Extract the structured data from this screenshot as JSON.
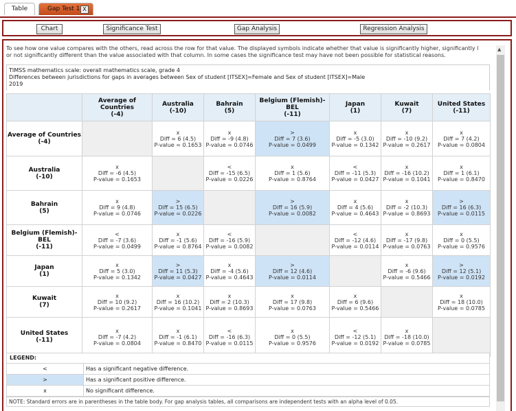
{
  "tabs": [
    {
      "label": "Table"
    },
    {
      "label": "Gap Test 1",
      "close": "X"
    }
  ],
  "toolbar": {
    "chart": "Chart",
    "significance": "Significance Test",
    "gap": "Gap Analysis",
    "regression": "Regression Analysis"
  },
  "intro": [
    "To see how one value compares with the others, read across the row for that value. The displayed symbols indicate whether that value is significantly higher, significantly l",
    "or not significantly different than the value associated with that column. In some cases the significance test may have not been possible for statistical reasons."
  ],
  "header": {
    "line1": "TIMSS mathematics scale: overall mathematics scale, grade 4",
    "line2": "Differences between jurisdictions for gaps in averages between Sex of student [ITSEX]=Female and Sex of student [ITSEX]=Male",
    "line3": "2019"
  },
  "table": {
    "columns": [
      {
        "name": "Average of Countries",
        "value": "(-4)"
      },
      {
        "name": "Australia",
        "value": "(-10)"
      },
      {
        "name": "Bahrain",
        "value": "(5)"
      },
      {
        "name": "Belgium (Flemish)-BEL",
        "value": "(-11)"
      },
      {
        "name": "Japan",
        "value": "(1)"
      },
      {
        "name": "Kuwait",
        "value": "(7)"
      },
      {
        "name": "United States",
        "value": "(-11)"
      }
    ],
    "rows": [
      {
        "name": "Average of Countries",
        "value": "(-4)",
        "cells": [
          null,
          {
            "sym": "x",
            "diff": "Diff = 6 (4.5)",
            "p": "P-value = 0.1653",
            "pos": false
          },
          {
            "sym": "x",
            "diff": "Diff = -9 (4.8)",
            "p": "P-value = 0.0746",
            "pos": false
          },
          {
            "sym": ">",
            "diff": "Diff = 7 (3.6)",
            "p": "P-value = 0.0499",
            "pos": true
          },
          {
            "sym": "x",
            "diff": "Diff = -5 (3.0)",
            "p": "P-value = 0.1342",
            "pos": false
          },
          {
            "sym": "x",
            "diff": "Diff = -10 (9.2)",
            "p": "P-value = 0.2617",
            "pos": false
          },
          {
            "sym": "x",
            "diff": "Diff = 7 (4.2)",
            "p": "P-value = 0.0804",
            "pos": false
          }
        ]
      },
      {
        "name": "Australia",
        "value": "(-10)",
        "cells": [
          {
            "sym": "x",
            "diff": "Diff = -6 (4.5)",
            "p": "P-value = 0.1653",
            "pos": false
          },
          null,
          {
            "sym": "<",
            "diff": "Diff = -15 (6.5)",
            "p": "P-value = 0.0226",
            "pos": false
          },
          {
            "sym": "x",
            "diff": "Diff = 1 (5.6)",
            "p": "P-value = 0.8764",
            "pos": false
          },
          {
            "sym": "<",
            "diff": "Diff = -11 (5.3)",
            "p": "P-value = 0.0427",
            "pos": false
          },
          {
            "sym": "x",
            "diff": "Diff = -16 (10.2)",
            "p": "P-value = 0.1041",
            "pos": false
          },
          {
            "sym": "x",
            "diff": "Diff = 1 (6.1)",
            "p": "P-value = 0.8470",
            "pos": false
          }
        ]
      },
      {
        "name": "Bahrain",
        "value": "(5)",
        "cells": [
          {
            "sym": "x",
            "diff": "Diff = 9 (4.8)",
            "p": "P-value = 0.0746",
            "pos": false
          },
          {
            "sym": ">",
            "diff": "Diff = 15 (6.5)",
            "p": "P-value = 0.0226",
            "pos": true
          },
          null,
          {
            "sym": ">",
            "diff": "Diff = 16 (5.9)",
            "p": "P-value = 0.0082",
            "pos": true
          },
          {
            "sym": "x",
            "diff": "Diff = 4 (5.6)",
            "p": "P-value = 0.4643",
            "pos": false
          },
          {
            "sym": "x",
            "diff": "Diff = -2 (10.3)",
            "p": "P-value = 0.8693",
            "pos": false
          },
          {
            "sym": ">",
            "diff": "Diff = 16 (6.3)",
            "p": "P-value = 0.0115",
            "pos": true
          }
        ]
      },
      {
        "name": "Belgium (Flemish)-BEL",
        "value": "(-11)",
        "cells": [
          {
            "sym": "<",
            "diff": "Diff = -7 (3.6)",
            "p": "P-value = 0.0499",
            "pos": false
          },
          {
            "sym": "x",
            "diff": "Diff = -1 (5.6)",
            "p": "P-value = 0.8764",
            "pos": false
          },
          {
            "sym": "<",
            "diff": "Diff = -16 (5.9)",
            "p": "P-value = 0.0082",
            "pos": false
          },
          null,
          {
            "sym": "<",
            "diff": "Diff = -12 (4.6)",
            "p": "P-value = 0.0114",
            "pos": false
          },
          {
            "sym": "x",
            "diff": "Diff = -17 (9.8)",
            "p": "P-value = 0.0763",
            "pos": false
          },
          {
            "sym": "x",
            "diff": "Diff = 0 (5.5)",
            "p": "P-value = 0.9576",
            "pos": false
          }
        ]
      },
      {
        "name": "Japan",
        "value": "(1)",
        "cells": [
          {
            "sym": "x",
            "diff": "Diff = 5 (3.0)",
            "p": "P-value = 0.1342",
            "pos": false
          },
          {
            "sym": ">",
            "diff": "Diff = 11 (5.3)",
            "p": "P-value = 0.0427",
            "pos": true
          },
          {
            "sym": "x",
            "diff": "Diff = -4 (5.6)",
            "p": "P-value = 0.4643",
            "pos": false
          },
          {
            "sym": ">",
            "diff": "Diff = 12 (4.6)",
            "p": "P-value = 0.0114",
            "pos": true
          },
          null,
          {
            "sym": "x",
            "diff": "Diff = -6 (9.6)",
            "p": "P-value = 0.5466",
            "pos": false
          },
          {
            "sym": ">",
            "diff": "Diff = 12 (5.1)",
            "p": "P-value = 0.0192",
            "pos": true
          }
        ]
      },
      {
        "name": "Kuwait",
        "value": "(7)",
        "cells": [
          {
            "sym": "x",
            "diff": "Diff = 10 (9.2)",
            "p": "P-value = 0.2617",
            "pos": false
          },
          {
            "sym": "x",
            "diff": "Diff = 16 (10.2)",
            "p": "P-value = 0.1041",
            "pos": false
          },
          {
            "sym": "x",
            "diff": "Diff = 2 (10.3)",
            "p": "P-value = 0.8693",
            "pos": false
          },
          {
            "sym": "x",
            "diff": "Diff = 17 (9.8)",
            "p": "P-value = 0.0763",
            "pos": false
          },
          {
            "sym": "x",
            "diff": "Diff = 6 (9.6)",
            "p": "P-value = 0.5466",
            "pos": false
          },
          null,
          {
            "sym": "x",
            "diff": "Diff = 18 (10.0)",
            "p": "P-value = 0.0785",
            "pos": false
          }
        ]
      },
      {
        "name": "United States",
        "value": "(-11)",
        "cells": [
          {
            "sym": "x",
            "diff": "Diff = -7 (4.2)",
            "p": "P-value = 0.0804",
            "pos": false
          },
          {
            "sym": "x",
            "diff": "Diff = -1 (6.1)",
            "p": "P-value = 0.8470",
            "pos": false
          },
          {
            "sym": "<",
            "diff": "Diff = -16 (6.3)",
            "p": "P-value = 0.0115",
            "pos": false
          },
          {
            "sym": "x",
            "diff": "Diff = 0 (5.5)",
            "p": "P-value = 0.9576",
            "pos": false
          },
          {
            "sym": "<",
            "diff": "Diff = -12 (5.1)",
            "p": "P-value = 0.0192",
            "pos": false
          },
          {
            "sym": "x",
            "diff": "Diff = -18 (10.0)",
            "p": "P-value = 0.0785",
            "pos": false
          },
          null
        ]
      }
    ]
  },
  "legend": {
    "title": "LEGEND:",
    "items": [
      {
        "sym": "<",
        "text": "Has a significant negative difference.",
        "pos": false
      },
      {
        "sym": ">",
        "text": "Has a significant positive difference.",
        "pos": true
      },
      {
        "sym": "x",
        "text": "No significant difference.",
        "pos": false
      }
    ]
  },
  "note": "NOTE: Standard errors are in parentheses in the table body. For gap analysis tables, all comparisons are independent tests with an alpha level of 0.05.",
  "colors": {
    "positive_fill": "#cfe3f6",
    "header_fill": "#e3eef7",
    "frame": "#8b1a1a",
    "active_tab": "#d9602b"
  }
}
